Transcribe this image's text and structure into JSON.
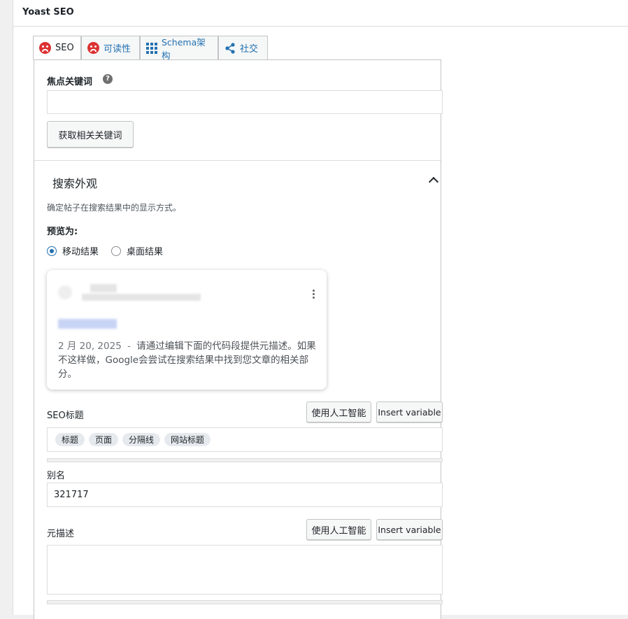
{
  "metabox": {
    "title": "Yoast SEO"
  },
  "tabs": [
    {
      "label": "SEO"
    },
    {
      "label": "可读性"
    },
    {
      "label": "Schema架构"
    },
    {
      "label": "社交"
    }
  ],
  "focus_keyword": {
    "label": "焦点关键词",
    "help": "?",
    "value": "",
    "related_button": "获取相关关键词"
  },
  "search_appearance": {
    "title": "搜索外观",
    "description": "确定帖子在搜索结果中的显示方式。",
    "preview_as_label": "预览为:",
    "options": [
      {
        "label": "移动结果",
        "checked": true
      },
      {
        "label": "桌面结果",
        "checked": false
      }
    ],
    "snippet": {
      "date": "2 月 20, 2025",
      "separator": "-",
      "text": "请通过编辑下面的代码段提供元描述。如果不这样做，Google会尝试在搜索结果中找到您文章的相关部分。"
    }
  },
  "seo_title": {
    "label": "SEO标题",
    "ai_button": "使用人工智能",
    "insert_button": "Insert variable",
    "tags": [
      "标题",
      "页面",
      "分隔线",
      "网站标题"
    ]
  },
  "slug": {
    "label": "别名",
    "value": "321717"
  },
  "meta_description": {
    "label": "元描述",
    "ai_button": "使用人工智能",
    "insert_button": "Insert variable",
    "value": ""
  },
  "colors": {
    "accent": "#2271b1",
    "error": "#dc3232"
  }
}
